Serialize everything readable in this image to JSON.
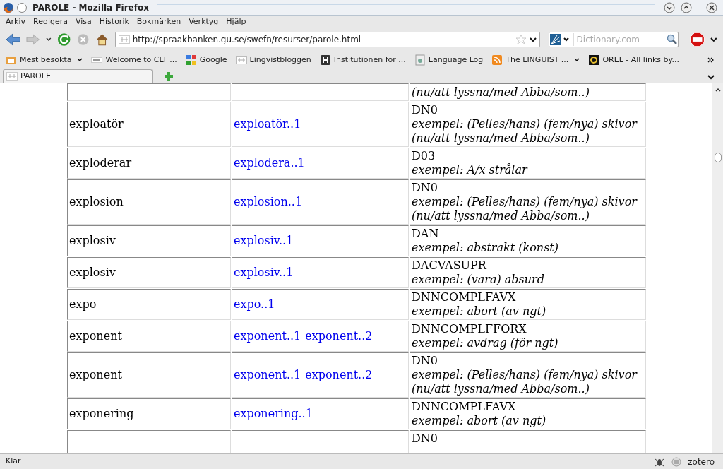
{
  "window": {
    "title": "PAROLE - Mozilla Firefox"
  },
  "menu": [
    "Arkiv",
    "Redigera",
    "Visa",
    "Historik",
    "Bokmärken",
    "Verktyg",
    "Hjälp"
  ],
  "url": "http://spraakbanken.gu.se/swefn/resurser/parole.html",
  "search": {
    "placeholder": "Dictionary.com"
  },
  "bookmarks": [
    {
      "label": "Mest besökta",
      "dropdown": true
    },
    {
      "label": "Welcome to CLT ...",
      "dropdown": false
    },
    {
      "label": "Google",
      "dropdown": false
    },
    {
      "label": "Lingvistbloggen",
      "dropdown": false
    },
    {
      "label": "Institutionen för ...",
      "dropdown": false
    },
    {
      "label": "Language Log",
      "dropdown": false
    },
    {
      "label": "The LINGUIST ...",
      "dropdown": true
    },
    {
      "label": "OREL - All links by...",
      "dropdown": false
    }
  ],
  "tabs": [
    {
      "label": "PAROLE",
      "selected": true
    }
  ],
  "table": {
    "rows": [
      {
        "word": "",
        "senses": [],
        "code": "",
        "example": "(nu/att lyssna/med Abba/som..)"
      },
      {
        "word": "exploatör",
        "senses": [
          "exploatör..1"
        ],
        "code": "DN0",
        "example": "exempel: (Pelles/hans) (fem/nya) skivor (nu/att lyssna/med Abba/som..)"
      },
      {
        "word": "exploderar",
        "senses": [
          "explodera..1"
        ],
        "code": "D03",
        "example": "exempel: A/x strålar"
      },
      {
        "word": "explosion",
        "senses": [
          "explosion..1"
        ],
        "code": "DN0",
        "example": "exempel: (Pelles/hans) (fem/nya) skivor (nu/att lyssna/med Abba/som..)"
      },
      {
        "word": "explosiv",
        "senses": [
          "explosiv..1"
        ],
        "code": "DAN",
        "example": "exempel: abstrakt (konst)"
      },
      {
        "word": "explosiv",
        "senses": [
          "explosiv..1"
        ],
        "code": "DACVASUPR",
        "example": "exempel: (vara) absurd"
      },
      {
        "word": "expo",
        "senses": [
          "expo..1"
        ],
        "code": "DNNCOMPLFAVX",
        "example": "exempel: abort (av ngt)"
      },
      {
        "word": "exponent",
        "senses": [
          "exponent..1",
          "exponent..2"
        ],
        "code": "DNNCOMPLFFORX",
        "example": "exempel: avdrag (för ngt)"
      },
      {
        "word": "exponent",
        "senses": [
          "exponent..1",
          "exponent..2"
        ],
        "code": "DN0",
        "example": "exempel: (Pelles/hans) (fem/nya) skivor (nu/att lyssna/med Abba/som..)"
      },
      {
        "word": "exponering",
        "senses": [
          "exponering..1"
        ],
        "code": "DNNCOMPLFAVX",
        "example": "exempel: abort (av ngt)"
      },
      {
        "word": "",
        "senses": [],
        "code": "DN0",
        "example": ""
      }
    ]
  },
  "status_bar": {
    "text": "Klar",
    "addon": "zotero"
  }
}
